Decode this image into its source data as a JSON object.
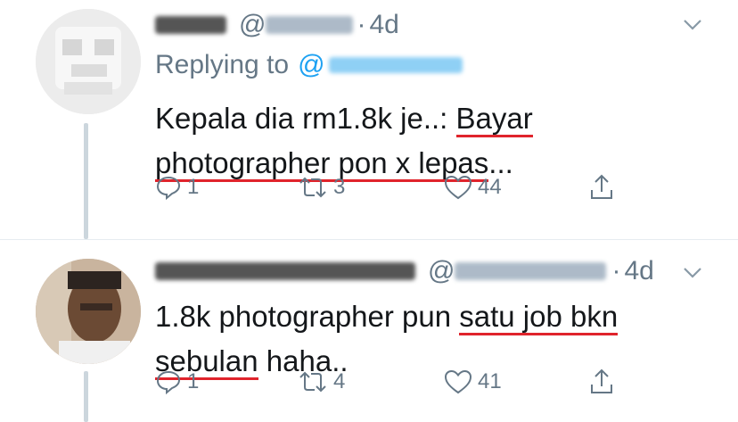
{
  "tweets": [
    {
      "handle_prefix": "@",
      "time": "4d",
      "replying_to_label": "Replying to",
      "replying_to_at": "@",
      "text_plain": "Kepala dia rm1.8k je..: ",
      "text_underlined_1": "Bayar",
      "text_underlined_2": "photographer pon x lepas",
      "text_tail": "...",
      "replies": "1",
      "retweets": "3",
      "likes": "44",
      "icons": {
        "reply": "reply-icon",
        "retweet": "retweet-icon",
        "like": "heart-icon",
        "share": "share-icon",
        "menu": "chevron-down-icon"
      }
    },
    {
      "handle_prefix": "@",
      "handle_tail": ".",
      "time": "4d",
      "text_plain": "1.8k photographer pun ",
      "text_underlined_1": "satu job bkn",
      "text_underlined_2": "sebulan",
      "text_tail": " haha..",
      "replies": "1",
      "retweets": "4",
      "likes": "41"
    }
  ],
  "colors": {
    "link": "#1da1f2",
    "muted": "#657786",
    "underline": "#e0242c"
  }
}
